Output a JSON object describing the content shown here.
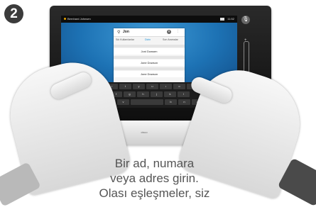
{
  "step": {
    "number": "2"
  },
  "statusbar": {
    "user": "Bernhard Johnsen",
    "time": "11:52"
  },
  "search": {
    "query": "Jon"
  },
  "tabs": {
    "favorites": "Sık Kullanılanlar",
    "directory": "Dizin",
    "recent": "Son Aramalar"
  },
  "results": [
    {
      "name": "Joni Dowsen"
    },
    {
      "name": "Jone Dowson"
    },
    {
      "name": "Jone Dowson"
    }
  ],
  "keyboard": {
    "row1": [
      "q",
      "w",
      "e",
      "r",
      "t",
      "y",
      "u",
      "ı",
      "o",
      "p"
    ],
    "row2": [
      "a",
      "s",
      "d",
      "f",
      "g",
      "h",
      "j",
      "k",
      "l"
    ],
    "row3": [
      "z",
      "x",
      "c",
      "v",
      "",
      "b",
      "n",
      "m"
    ],
    "backspace": "⌫",
    "call": "Çağrı"
  },
  "brand": {
    "logo": "cisco"
  },
  "caption": {
    "line1": "Bir ad, numara",
    "line2": "veya adres girin.",
    "line3": "Olası eşleşmeler, siz"
  },
  "colors": {
    "screen": "#1c6fb0",
    "call_key": "#3cb04a",
    "active_tab": "#1a8fd6"
  }
}
